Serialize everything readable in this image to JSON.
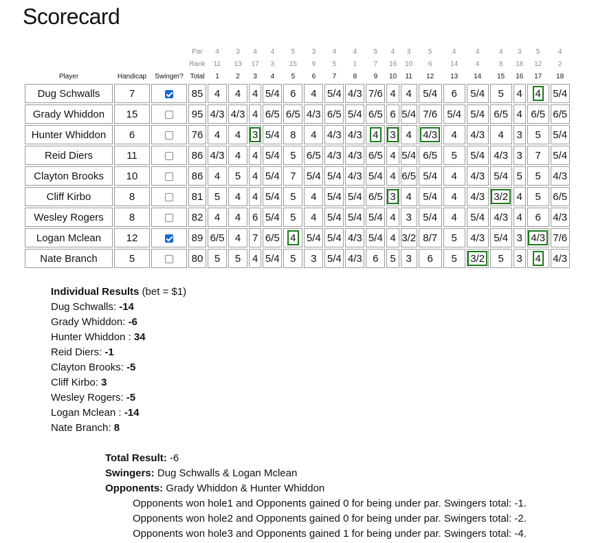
{
  "title": "Scorecard",
  "headers": {
    "par_label": "Par",
    "rank_label": "Rank",
    "player": "Player",
    "handicap": "Handicap",
    "swinger": "Swinger?",
    "total": "Total",
    "par": [
      "4",
      "3",
      "4",
      "4",
      "5",
      "3",
      "4",
      "4",
      "5",
      "4",
      "3",
      "5",
      "4",
      "4",
      "4",
      "3",
      "5",
      "4"
    ],
    "rank": [
      "11",
      "13",
      "17",
      "3",
      "15",
      "9",
      "5",
      "1",
      "7",
      "16",
      "10",
      "6",
      "14",
      "4",
      "8",
      "18",
      "12",
      "2"
    ],
    "holes": [
      "1",
      "2",
      "3",
      "4",
      "5",
      "6",
      "7",
      "8",
      "9",
      "10",
      "11",
      "12",
      "13",
      "14",
      "15",
      "16",
      "17",
      "18"
    ]
  },
  "players": [
    {
      "name": "Dug Schwalls",
      "handicap": "7",
      "swinger": true,
      "total": "85",
      "scores": [
        "4",
        "4",
        "4",
        "5/4",
        "6",
        "4",
        "5/4",
        "4/3",
        "7/6",
        "4",
        "4",
        "5/4",
        "6",
        "5/4",
        "5",
        "4",
        "4",
        "5/4"
      ],
      "hl": [
        17
      ]
    },
    {
      "name": "Grady Whiddon",
      "handicap": "15",
      "swinger": false,
      "total": "95",
      "scores": [
        "4/3",
        "4/3",
        "4",
        "6/5",
        "6/5",
        "4/3",
        "6/5",
        "5/4",
        "6/5",
        "6",
        "5/4",
        "7/6",
        "5/4",
        "5/4",
        "6/5",
        "4",
        "6/5",
        "6/5"
      ],
      "hl": []
    },
    {
      "name": "Hunter Whiddon",
      "handicap": "6",
      "swinger": false,
      "total": "76",
      "scores": [
        "4",
        "4",
        "3",
        "5/4",
        "8",
        "4",
        "4/3",
        "4/3",
        "4",
        "3",
        "4",
        "4/3",
        "4",
        "4/3",
        "4",
        "3",
        "5",
        "5/4"
      ],
      "hl": [
        3,
        9,
        10,
        12
      ]
    },
    {
      "name": "Reid Diers",
      "handicap": "11",
      "swinger": false,
      "total": "86",
      "scores": [
        "4/3",
        "4",
        "4",
        "5/4",
        "5",
        "6/5",
        "4/3",
        "4/3",
        "6/5",
        "4",
        "5/4",
        "6/5",
        "5",
        "5/4",
        "4/3",
        "3",
        "7",
        "5/4"
      ],
      "hl": []
    },
    {
      "name": "Clayton Brooks",
      "handicap": "10",
      "swinger": false,
      "total": "86",
      "scores": [
        "4",
        "5",
        "4",
        "5/4",
        "7",
        "5/4",
        "5/4",
        "4/3",
        "5/4",
        "4",
        "6/5",
        "5/4",
        "4",
        "4/3",
        "5/4",
        "5",
        "5",
        "4/3"
      ],
      "hl": []
    },
    {
      "name": "Cliff Kirbo",
      "handicap": "8",
      "swinger": false,
      "total": "81",
      "scores": [
        "5",
        "4",
        "4",
        "5/4",
        "5",
        "4",
        "5/4",
        "5/4",
        "6/5",
        "3",
        "4",
        "5/4",
        "4",
        "4/3",
        "3/2",
        "4",
        "5",
        "6/5"
      ],
      "hl": [
        10,
        15
      ]
    },
    {
      "name": "Wesley Rogers",
      "handicap": "8",
      "swinger": false,
      "total": "82",
      "scores": [
        "4",
        "4",
        "6",
        "5/4",
        "5",
        "4",
        "5/4",
        "5/4",
        "5/4",
        "4",
        "3",
        "5/4",
        "4",
        "5/4",
        "4/3",
        "4",
        "6",
        "4/3"
      ],
      "hl": []
    },
    {
      "name": "Logan Mclean",
      "handicap": "12",
      "swinger": true,
      "total": "89",
      "scores": [
        "6/5",
        "4",
        "7",
        "6/5",
        "4",
        "5/4",
        "5/4",
        "4/3",
        "5/4",
        "4",
        "3/2",
        "8/7",
        "5",
        "4/3",
        "5/4",
        "3",
        "4/3",
        "7/6"
      ],
      "hl": [
        5,
        17
      ]
    },
    {
      "name": "Nate Branch",
      "handicap": "5",
      "swinger": false,
      "total": "80",
      "scores": [
        "5",
        "5",
        "4",
        "5/4",
        "5",
        "3",
        "5/4",
        "4/3",
        "6",
        "5",
        "3",
        "6",
        "5",
        "3/2",
        "5",
        "3",
        "4",
        "4/3"
      ],
      "hl": [
        14,
        17
      ]
    }
  ],
  "results": {
    "heading": "Individual Results",
    "bet": "(bet = $1)",
    "items": [
      {
        "name": "Dug Schwalls:",
        "value": "-14"
      },
      {
        "name": "Grady Whiddon:",
        "value": "-6"
      },
      {
        "name": "Hunter Whiddon :",
        "value": "34"
      },
      {
        "name": "Reid Diers:",
        "value": "-1"
      },
      {
        "name": "Clayton Brooks:",
        "value": "-5"
      },
      {
        "name": "Cliff Kirbo:",
        "value": "3"
      },
      {
        "name": "Wesley Rogers:",
        "value": "-5"
      },
      {
        "name": "Logan Mclean :",
        "value": "-14"
      },
      {
        "name": "Nate Branch:",
        "value": "8"
      }
    ]
  },
  "summary": {
    "total_label": "Total Result:",
    "total_value": " -6",
    "swingers_label": "Swingers:",
    "swingers_value": " Dug Schwalls & Logan Mclean",
    "opponents_label": "Opponents:",
    "opponents_value": " Grady Whiddon & Hunter Whiddon",
    "lines": [
      "Opponents won hole1 and Opponents gained 0 for being under par. Swingers total: -1.",
      "Opponents won hole2 and Opponents gained 0 for being under par. Swingers total: -2.",
      "Opponents won hole3 and Opponents gained 1 for being under par. Swingers total: -4."
    ]
  }
}
